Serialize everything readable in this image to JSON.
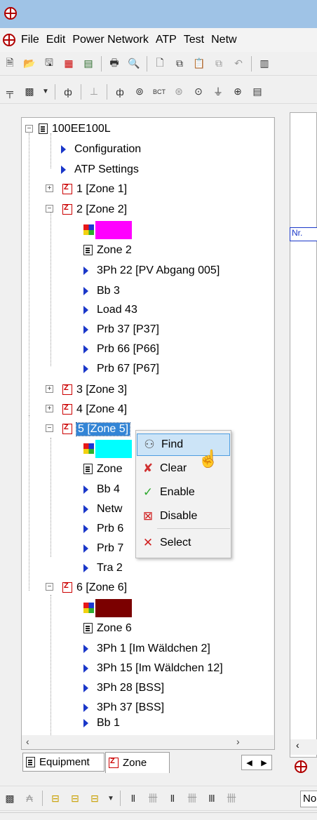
{
  "menu": [
    "File",
    "Edit",
    "Power Network",
    "ATP",
    "Test",
    "Netw"
  ],
  "tree": {
    "root": "100EE100L",
    "root_children": [
      "Configuration",
      "ATP Settings"
    ],
    "zone1": "1 [Zone 1]",
    "zone2": "2 [Zone 2]",
    "zone2_color": "#ff00ff",
    "zone2_items": [
      "Zone 2",
      "3Ph 22 [PV Abgang 005]",
      "Bb 3",
      "Load 43",
      "Prb 37 [P37]",
      "Prb 66 [P66]",
      "Prb 67 [P67]"
    ],
    "zone3": "3 [Zone 3]",
    "zone4": "4 [Zone 4]",
    "zone5": "5 [Zone 5]",
    "zone5_color": "#00ffff",
    "zone5_items": [
      "Zone",
      "Bb 4",
      "Netw",
      "Prb 6",
      "Prb 7",
      "Tra 2"
    ],
    "zone6": "6 [Zone 6]",
    "zone6_color": "#7b0000",
    "zone6_items": [
      "Zone 6",
      "3Ph 1 [Im Wäldchen 2]",
      "3Ph 15 [Im Wäldchen 12]",
      "3Ph 28 [BSS]",
      "3Ph 37 [BSS]",
      "Bb 1"
    ]
  },
  "context_menu": {
    "find": "Find",
    "clear": "Clear",
    "enable": "Enable",
    "disable": "Disable",
    "select": "Select"
  },
  "tabs": {
    "equipment": "Equipment",
    "zone": "Zone"
  },
  "right_panel": {
    "nr_label": "Nr."
  },
  "bottom": {
    "status_text": "No"
  }
}
